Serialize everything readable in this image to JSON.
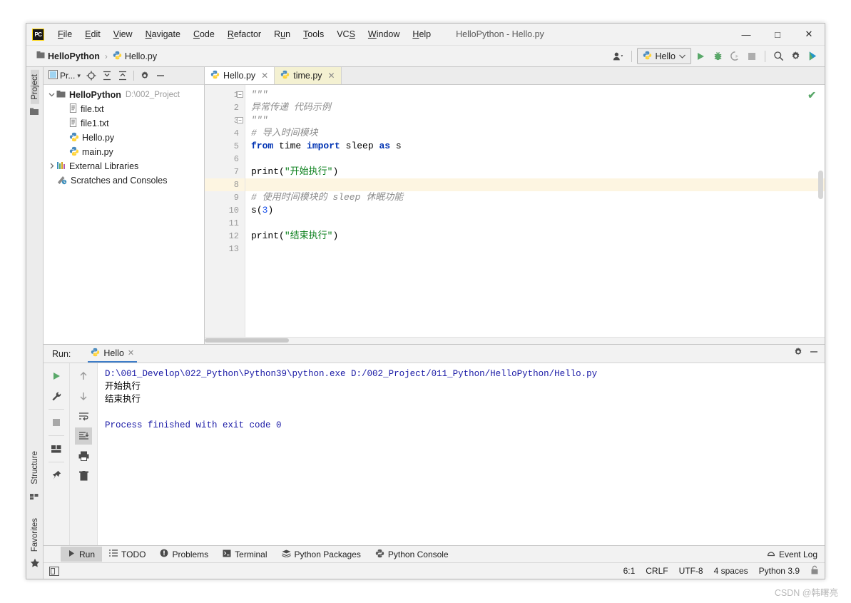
{
  "window": {
    "title": "HelloPython - Hello.py",
    "logo_text": "PC",
    "minimize": "—",
    "maximize": "□",
    "close": "✕"
  },
  "menu": {
    "items": [
      {
        "label": "File"
      },
      {
        "label": "Edit"
      },
      {
        "label": "View"
      },
      {
        "label": "Navigate"
      },
      {
        "label": "Code"
      },
      {
        "label": "Refactor"
      },
      {
        "label": "Run"
      },
      {
        "label": "Tools"
      },
      {
        "label": "VCS"
      },
      {
        "label": "Window"
      },
      {
        "label": "Help"
      }
    ]
  },
  "navbar": {
    "breadcrumb": [
      {
        "label": "HelloPython",
        "icon": "project-icon"
      },
      {
        "label": "Hello.py",
        "icon": "python-file-icon"
      }
    ],
    "separator": "›",
    "run_config": "Hello",
    "run_config_chevron": "⌄",
    "buttons": [
      {
        "name": "user-settings-icon"
      },
      {
        "name": "run-icon"
      },
      {
        "name": "debug-icon"
      },
      {
        "name": "run-coverage-icon"
      },
      {
        "name": "stop-icon"
      },
      {
        "name": "search-icon"
      },
      {
        "name": "settings-gear-icon"
      },
      {
        "name": "updates-icon"
      }
    ]
  },
  "left_strip": {
    "project_tab": "Project",
    "structure_tab": "Structure",
    "favorites_tab": "Favorites"
  },
  "project_pane": {
    "title": "Pr...",
    "header_buttons": [
      {
        "name": "scroll-from-source-icon"
      },
      {
        "name": "expand-all-icon"
      },
      {
        "name": "collapse-all-icon"
      },
      {
        "name": "pane-settings-icon"
      },
      {
        "name": "hide-pane-icon"
      }
    ],
    "tree": [
      {
        "label": "HelloPython",
        "sub": "D:\\002_Project",
        "icon": "folder-icon",
        "twisty": "⌄",
        "bold": true,
        "indent": 0
      },
      {
        "label": "file.txt",
        "sub": "",
        "icon": "text-file-icon",
        "twisty": "",
        "bold": false,
        "indent": 1
      },
      {
        "label": "file1.txt",
        "sub": "",
        "icon": "text-file-icon",
        "twisty": "",
        "bold": false,
        "indent": 1
      },
      {
        "label": "Hello.py",
        "sub": "",
        "icon": "python-file-icon",
        "twisty": "",
        "bold": false,
        "indent": 1
      },
      {
        "label": "main.py",
        "sub": "",
        "icon": "python-file-icon",
        "twisty": "",
        "bold": false,
        "indent": 1
      },
      {
        "label": "External Libraries",
        "sub": "",
        "icon": "library-icon",
        "twisty": "›",
        "bold": false,
        "indent": 0
      },
      {
        "label": "Scratches and Consoles",
        "sub": "",
        "icon": "scratches-icon",
        "twisty": "",
        "bold": false,
        "indent": 0
      }
    ]
  },
  "editor": {
    "tabs": [
      {
        "label": "Hello.py",
        "icon": "python-file-icon",
        "active": true,
        "modified": false,
        "close": "✕"
      },
      {
        "label": "time.py",
        "icon": "python-file-icon",
        "active": false,
        "modified": true,
        "close": "✕"
      }
    ],
    "current_line": 8,
    "inspection_status": "✔",
    "lines": [
      {
        "n": 1,
        "tokens": [
          {
            "t": "\"\"\"",
            "c": "cm"
          }
        ]
      },
      {
        "n": 2,
        "tokens": [
          {
            "t": "异常传递 代码示例",
            "c": "cm"
          }
        ]
      },
      {
        "n": 3,
        "tokens": [
          {
            "t": "\"\"\"",
            "c": "cm"
          }
        ]
      },
      {
        "n": 4,
        "tokens": [
          {
            "t": "# 导入时间模块",
            "c": "cm"
          }
        ]
      },
      {
        "n": 5,
        "tokens": [
          {
            "t": "from",
            "c": "kw"
          },
          {
            "t": " time ",
            "c": "fn"
          },
          {
            "t": "import",
            "c": "kw"
          },
          {
            "t": " sleep ",
            "c": "fn"
          },
          {
            "t": "as",
            "c": "kw"
          },
          {
            "t": " s",
            "c": "fn"
          }
        ]
      },
      {
        "n": 6,
        "tokens": []
      },
      {
        "n": 7,
        "tokens": [
          {
            "t": "print",
            "c": "fn"
          },
          {
            "t": "(",
            "c": "fn"
          },
          {
            "t": "\"开始执行\"",
            "c": "st"
          },
          {
            "t": ")",
            "c": "fn"
          }
        ]
      },
      {
        "n": 8,
        "tokens": []
      },
      {
        "n": 9,
        "tokens": [
          {
            "t": "# 使用时间模块的 sleep 休眠功能",
            "c": "cm"
          }
        ]
      },
      {
        "n": 10,
        "tokens": [
          {
            "t": "s",
            "c": "fn"
          },
          {
            "t": "(",
            "c": "fn"
          },
          {
            "t": "3",
            "c": "num"
          },
          {
            "t": ")",
            "c": "fn"
          }
        ]
      },
      {
        "n": 11,
        "tokens": []
      },
      {
        "n": 12,
        "tokens": [
          {
            "t": "print",
            "c": "fn"
          },
          {
            "t": "(",
            "c": "fn"
          },
          {
            "t": "\"结束执行\"",
            "c": "st"
          },
          {
            "t": ")",
            "c": "fn"
          }
        ]
      },
      {
        "n": 13,
        "tokens": []
      }
    ]
  },
  "run_pane": {
    "label": "Run:",
    "tab_label": "Hello",
    "tab_close": "✕",
    "header_buttons": [
      {
        "name": "run-settings-gear-icon"
      },
      {
        "name": "hide-run-pane-icon"
      }
    ],
    "tools_col1": [
      {
        "name": "rerun-icon"
      },
      {
        "name": "run-configuration-icon"
      },
      {
        "name": "stop-process-icon"
      },
      {
        "name": "layout-icon"
      },
      {
        "name": "pin-tab-icon"
      }
    ],
    "tools_col2": [
      {
        "name": "up-arrow-icon"
      },
      {
        "name": "down-arrow-icon"
      },
      {
        "name": "soft-wrap-icon"
      },
      {
        "name": "scroll-to-end-icon"
      },
      {
        "name": "print-icon"
      },
      {
        "name": "clear-all-icon"
      }
    ],
    "console": [
      {
        "text": "D:\\001_Develop\\022_Python\\Python39\\python.exe D:/002_Project/011_Python/HelloPython/Hello.py",
        "style": "link"
      },
      {
        "text": "开始执行",
        "style": "out"
      },
      {
        "text": "结束执行",
        "style": "out"
      },
      {
        "text": "",
        "style": "out"
      },
      {
        "text": "Process finished with exit code 0",
        "style": "fin"
      }
    ]
  },
  "bottom_bar": {
    "tabs": [
      {
        "label": "Run",
        "icon": "run-triangle-icon",
        "active": true
      },
      {
        "label": "TODO",
        "icon": "todo-list-icon",
        "active": false
      },
      {
        "label": "Problems",
        "icon": "problems-icon",
        "active": false
      },
      {
        "label": "Terminal",
        "icon": "terminal-icon",
        "active": false
      },
      {
        "label": "Python Packages",
        "icon": "packages-icon",
        "active": false
      },
      {
        "label": "Python Console",
        "icon": "python-console-icon",
        "active": false
      }
    ],
    "event_log": "Event Log",
    "event_log_icon": "event-log-icon"
  },
  "status_bar": {
    "toggle_icon": "toggle-toolwindows-icon",
    "caret": "6:1",
    "line_separator": "CRLF",
    "encoding": "UTF-8",
    "indent": "4 spaces",
    "interpreter": "Python 3.9",
    "lock_icon": "lock-icon"
  },
  "watermark": "CSDN @韩曙亮",
  "colors": {
    "accent_blue": "#3d7dc9",
    "run_green": "#59a869",
    "keyword": "#0033b3",
    "string": "#067d17",
    "comment": "#8c8c8c",
    "number": "#1750eb",
    "console_link": "#1a1aa6",
    "current_line": "#fdf5e1"
  }
}
